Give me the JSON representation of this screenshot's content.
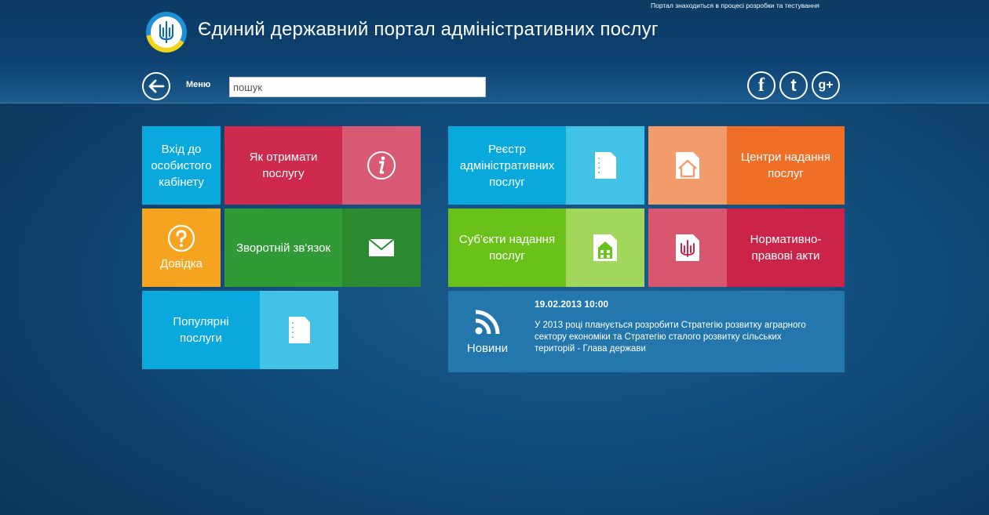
{
  "header": {
    "notice": "Портал знаходиться в процесі розробки та тестування",
    "title": "Єдиний державний портал адміністративних послуг",
    "menu_label": "Меню",
    "search_placeholder": "пошук"
  },
  "tiles": {
    "personal_cabinet": "Вхід до особистого кабінету",
    "how_to_get": "Як отримати послугу",
    "help": "Довідка",
    "feedback": "Зворотній зв'язок",
    "popular": "Популярні послуги",
    "registry": "Реєстр адміністративних послуг",
    "centers": "Центри надання послуг",
    "subjects": "Суб'єкти надання послуг",
    "normative": "Нормативно-правові акти"
  },
  "news": {
    "label": "Новини",
    "date": "19.02.2013 10:00",
    "text": "У 2013 році планується розробити Стратегію розвитку аграрного сектору економіки та Стратегію сталого розвитку сільських територій - Глава держави"
  },
  "colors": {
    "cyan": "#0aa9dd",
    "cyan_light": "#43c2e8",
    "crimson": "#cd2a4d",
    "pink": "#d95a75",
    "orange": "#f6a41f",
    "green_dark": "#2f9a36",
    "green_deep": "#2b8a2f",
    "lime": "#6ac119",
    "lime_light": "#a3d65c",
    "peach": "#f29c6c",
    "orange_dark": "#ef6f27",
    "rose": "#d8566e",
    "red": "#cc2448",
    "news_blue": "#2377ad"
  }
}
